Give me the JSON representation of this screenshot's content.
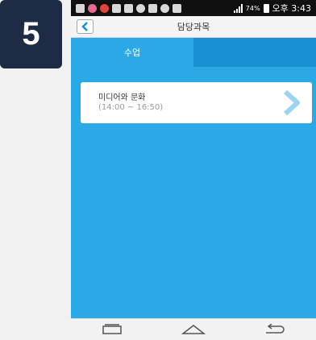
{
  "step": "5",
  "status_bar": {
    "battery": "74%",
    "time": "오후 3:43"
  },
  "header": {
    "title": "담당과목",
    "back_icon": "chevron-left-icon"
  },
  "tabs": [
    {
      "label": "수업",
      "active": true
    },
    {
      "label": "",
      "active": false
    }
  ],
  "courses": [
    {
      "name": "미디어와 문화",
      "time": "(14:00 ~ 16:50)"
    }
  ],
  "nav": [
    "recent-apps-icon",
    "home-icon",
    "back-arrow-icon"
  ],
  "colors": {
    "accent": "#2aa9e6",
    "tab_inactive": "#1a8fd3",
    "badge": "#1d2b45"
  }
}
